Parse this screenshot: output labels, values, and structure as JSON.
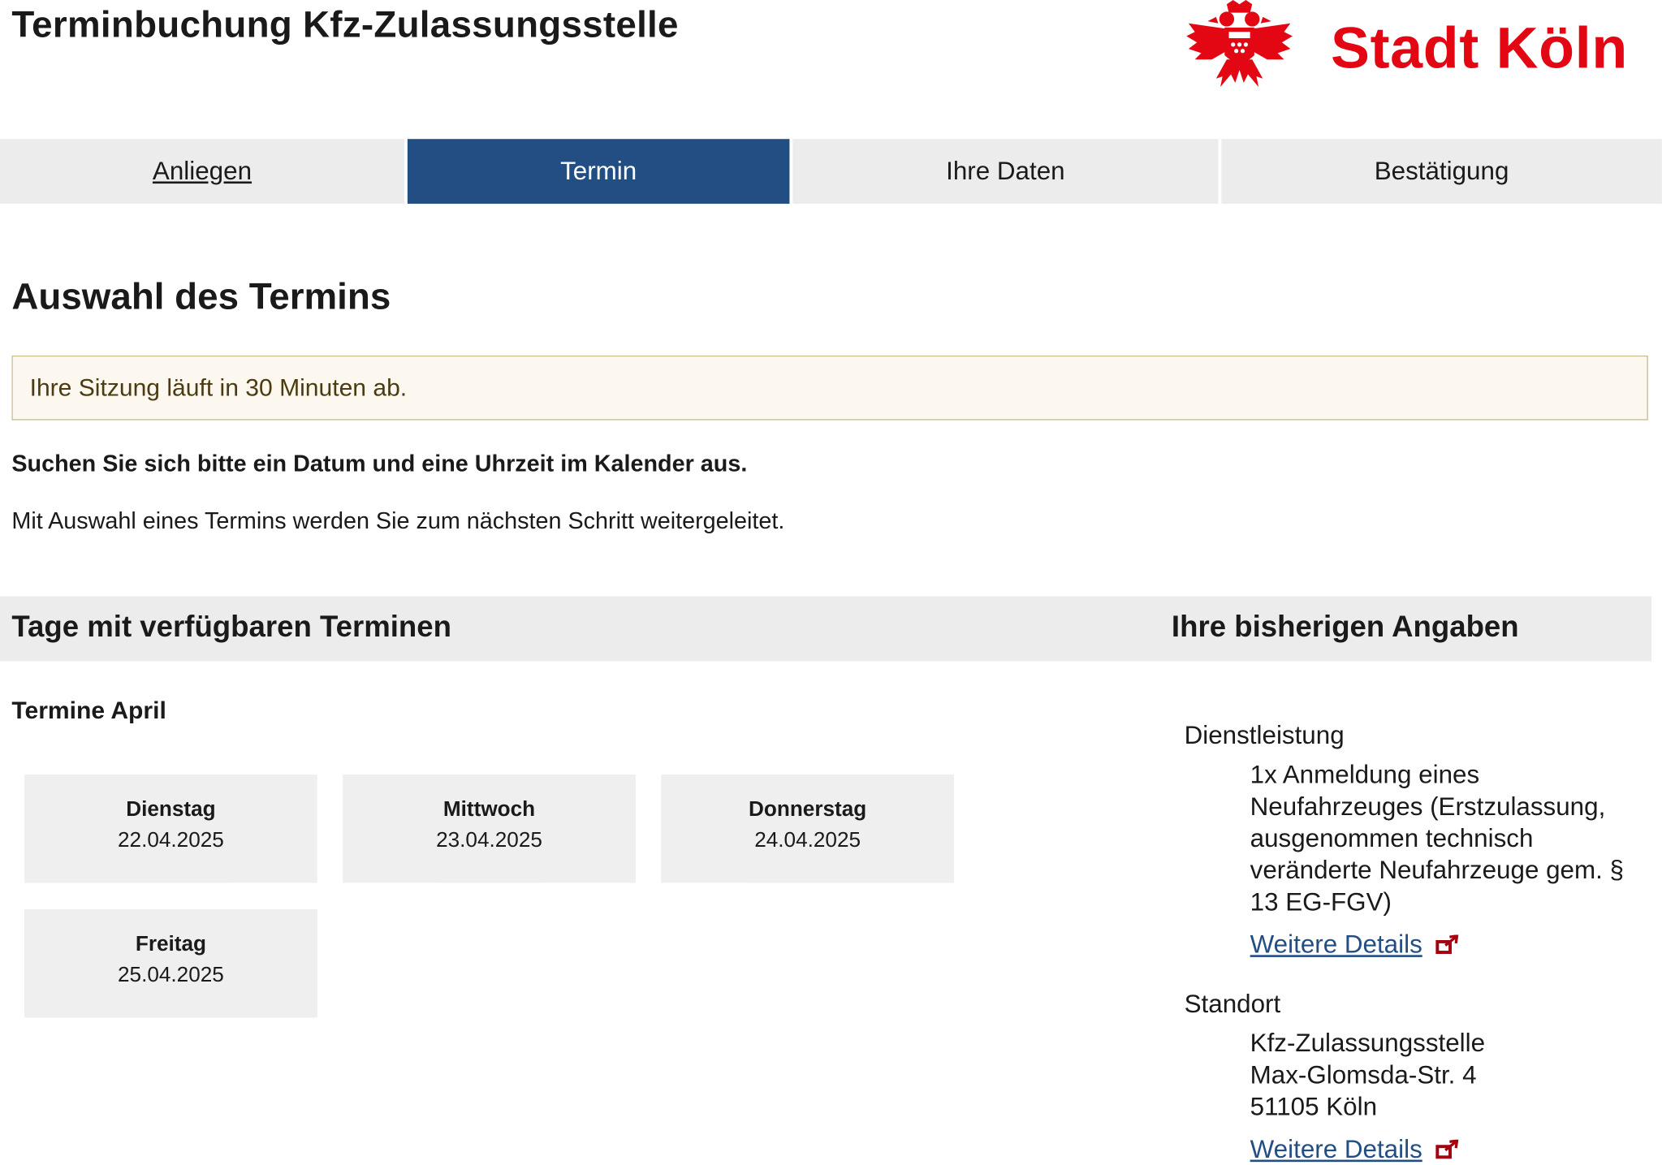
{
  "header": {
    "title": "Terminbuchung Kfz-Zulassungsstelle",
    "logo_text": "Stadt Köln",
    "brand_color": "#e30613"
  },
  "steps": [
    {
      "label": "Anliegen",
      "state": "done"
    },
    {
      "label": "Termin",
      "state": "active"
    },
    {
      "label": "Ihre Daten",
      "state": "pending"
    },
    {
      "label": "Bestätigung",
      "state": "pending"
    }
  ],
  "accent_color": "#234e84",
  "main": {
    "title": "Auswahl des Termins",
    "session_notice": "Ihre Sitzung läuft in 30 Minuten ab.",
    "instruction_bold": "Suchen Sie sich bitte ein Datum und eine Uhrzeit im Kalender aus.",
    "instruction": "Mit Auswahl eines Termins werden Sie zum nächsten Schritt weitergeleitet."
  },
  "available": {
    "heading": "Tage mit verfügbaren Terminen",
    "month_title": "Termine April",
    "days": [
      {
        "weekday": "Dienstag",
        "date": "22.04.2025"
      },
      {
        "weekday": "Mittwoch",
        "date": "23.04.2025"
      },
      {
        "weekday": "Donnerstag",
        "date": "24.04.2025"
      },
      {
        "weekday": "Freitag",
        "date": "25.04.2025"
      }
    ]
  },
  "summary": {
    "heading": "Ihre bisherigen Angaben",
    "service_label": "Dienstleistung",
    "service_text": "1x  Anmeldung eines Neufahrzeuges (Erstzulassung, ausgenommen technisch veränderte Neufahrzeuge gem. § 13 EG-FGV)",
    "service_link": "Weitere Details",
    "location_label": "Standort",
    "location_lines": [
      "Kfz-Zulassungsstelle",
      "Max-Glomsda-Str. 4",
      "51105 Köln"
    ],
    "location_link": "Weitere Details",
    "link_icon": "external-link-icon"
  }
}
